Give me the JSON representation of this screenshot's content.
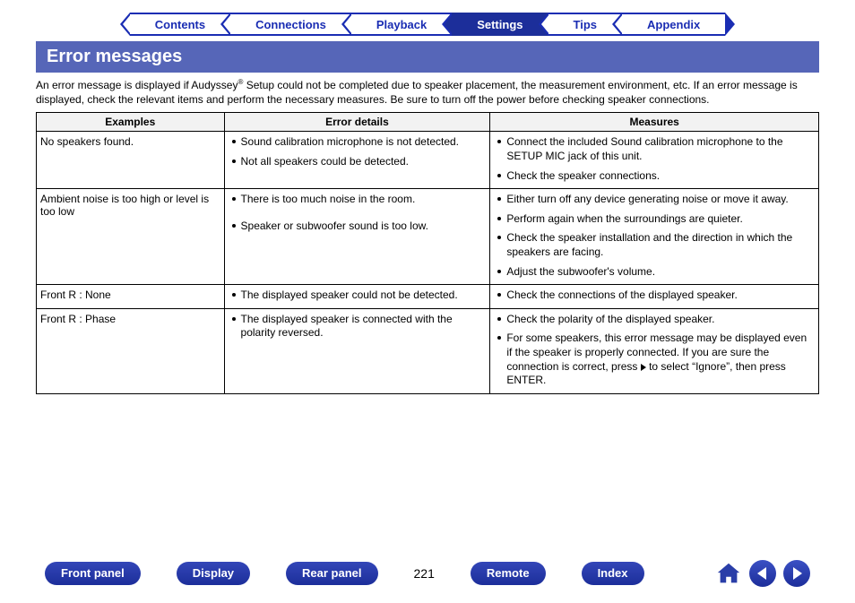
{
  "tabs": [
    {
      "label": "Contents",
      "active": false
    },
    {
      "label": "Connections",
      "active": false
    },
    {
      "label": "Playback",
      "active": false
    },
    {
      "label": "Settings",
      "active": true
    },
    {
      "label": "Tips",
      "active": false
    },
    {
      "label": "Appendix",
      "active": false
    }
  ],
  "heading": "Error messages",
  "intro_pre": "An error message is displayed if Audyssey",
  "intro_sup": "®",
  "intro_post": " Setup could not be completed due to speaker placement, the measurement environment, etc. If an error message is displayed, check the relevant items and perform the necessary measures. Be sure to turn off the power before checking speaker connections.",
  "table": {
    "headers": [
      "Examples",
      "Error details",
      "Measures"
    ],
    "rows": [
      {
        "example": "No speakers found.",
        "details": [
          "Sound calibration microphone is not detected.",
          "Not all speakers could be detected."
        ],
        "measures": [
          "Connect the included Sound calibration microphone to the SETUP MIC jack of this unit.",
          "Check the speaker connections."
        ]
      },
      {
        "example": "Ambient noise is too high or level is too low",
        "details": [
          "There is too much noise in the room.",
          "Speaker or subwoofer sound is too low."
        ],
        "measures": [
          "Either turn off any device generating noise or move it away.",
          "Perform again when the surroundings are quieter.",
          "Check the speaker installation and the direction in which the speakers are facing.",
          "Adjust the subwoofer's volume."
        ]
      },
      {
        "example": "Front R : None",
        "details": [
          "The displayed speaker could not be detected."
        ],
        "measures": [
          "Check the connections of the displayed speaker."
        ]
      },
      {
        "example": "Front R : Phase",
        "details": [
          "The displayed speaker is connected with the polarity reversed."
        ],
        "measures": [
          "Check the polarity of the displayed speaker.",
          "For some speakers, this error message may be displayed even if the speaker is properly connected. If you are sure the connection is correct, press ▷ to select \"Ignore\", then press ENTER."
        ]
      }
    ]
  },
  "footer": {
    "buttons": [
      "Front panel",
      "Display",
      "Rear panel"
    ],
    "page_number": "221",
    "buttons2": [
      "Remote",
      "Index"
    ]
  }
}
